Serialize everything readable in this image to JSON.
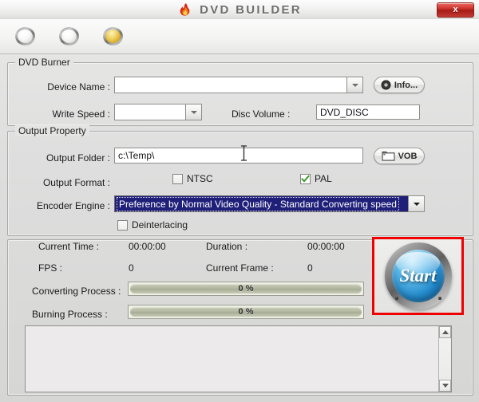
{
  "window": {
    "title": "DVD BUILDER",
    "flame_icon": "flame-icon",
    "close_label": "x"
  },
  "toolbar": {
    "steps": [
      {
        "name": "step-1",
        "state": "idle"
      },
      {
        "name": "step-2",
        "state": "idle"
      },
      {
        "name": "step-3",
        "state": "active"
      }
    ]
  },
  "burner": {
    "group_title": "DVD Burner",
    "device_name_label": "Device Name :",
    "device_name_value": "",
    "info_button_label": "Info...",
    "info_icon": "disc-icon",
    "write_speed_label": "Write Speed :",
    "write_speed_value": "",
    "disc_volume_label": "Disc Volume :",
    "disc_volume_value": "DVD_DISC"
  },
  "output": {
    "group_title": "Output Property",
    "output_folder_label": "Output Folder :",
    "output_folder_value": "c:\\Temp\\",
    "vob_button_label": "VOB",
    "vob_icon": "folder-icon",
    "output_format_label": "Output Format :",
    "ntsc_label": "NTSC",
    "ntsc_checked": false,
    "pal_label": "PAL",
    "pal_checked": true,
    "encoder_engine_label": "Encoder Engine :",
    "encoder_engine_value": "Preference by Normal Video Quality - Standard Converting speed",
    "encoder_selected": true,
    "deinterlacing_label": "Deinterlacing",
    "deinterlacing_checked": false
  },
  "status": {
    "current_time_label": "Current Time :",
    "current_time_value": "00:00:00",
    "duration_label": "Duration :",
    "duration_value": "00:00:00",
    "fps_label": "FPS :",
    "fps_value": "0",
    "current_frame_label": "Current Frame :",
    "current_frame_value": "0",
    "converting_label": "Converting Process :",
    "converting_value": "0 %",
    "burning_label": "Burning Process :",
    "burning_value": "0 %",
    "log_text": ""
  },
  "start": {
    "label": "Start",
    "highlight_color": "#f00000"
  },
  "colors": {
    "window_bg": "#e4e4e2",
    "titlebar_text": "#6e6e6e",
    "close_red": "#c23a33",
    "selection_navy": "#1f1f7a",
    "progress_olive": "#b4b9a2",
    "check_green": "#3f9b2f",
    "active_orb_gold": "#d8ac24",
    "start_blue": "#2288c9"
  }
}
